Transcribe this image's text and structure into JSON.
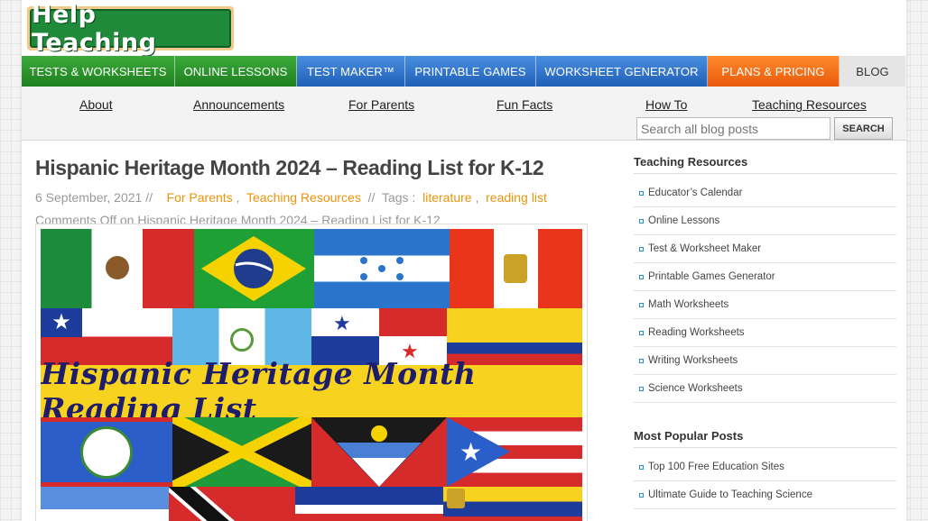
{
  "logo": {
    "text": "Help Teaching"
  },
  "main_nav": [
    {
      "label": "TESTS & WORKSHEETS",
      "color": "green"
    },
    {
      "label": "ONLINE LESSONS",
      "color": "green"
    },
    {
      "label": "TEST MAKER™",
      "color": "blue"
    },
    {
      "label": "PRINTABLE GAMES",
      "color": "blue"
    },
    {
      "label": "WORKSHEET GENERATOR",
      "color": "blue"
    },
    {
      "label": "PLANS & PRICING",
      "color": "orange"
    },
    {
      "label": "BLOG",
      "color": "gray"
    }
  ],
  "sub_nav": [
    "About",
    "Announcements",
    "For Parents",
    "Fun Facts",
    "How To",
    "Teaching Resources"
  ],
  "search": {
    "placeholder": "Search all blog posts",
    "button": "SEARCH"
  },
  "post": {
    "title": "Hispanic Heritage Month 2024 – Reading List for K-12",
    "date": "6 September, 2021",
    "sep": "//",
    "categories": [
      "For Parents",
      "Teaching Resources"
    ],
    "tags_label": "Tags :",
    "tags": [
      "literature",
      "reading list"
    ],
    "comments": "Comments Off on Hispanic Heritage Month 2024 – Reading List for K-12",
    "image_banner": "Hispanic Heritage Month Reading List"
  },
  "sidebar": {
    "resources_heading": "Teaching Resources",
    "resources": [
      "Educator’s Calendar",
      "Online Lessons",
      "Test & Worksheet Maker",
      "Printable Games Generator",
      "Math Worksheets",
      "Reading Worksheets",
      "Writing Worksheets",
      "Science Worksheets"
    ],
    "popular_heading": "Most Popular Posts",
    "popular": [
      "Top 100 Free Education Sites",
      "Ultimate Guide to Teaching Science"
    ]
  },
  "colors": {
    "nav_green": "#2a952a",
    "nav_blue": "#2f74cc",
    "nav_orange": "#f06f1a",
    "link_orange": "#e8940c",
    "bullet_blue": "#2b8fc9"
  }
}
